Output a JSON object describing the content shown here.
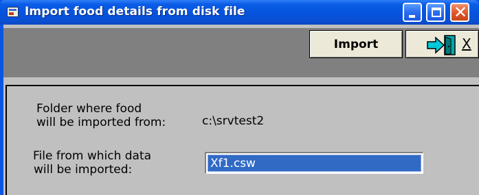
{
  "window": {
    "title": "Import food details from disk file",
    "controls": {
      "minimize": "minimize-icon",
      "maximize": "maximize-icon",
      "close": "close-icon"
    }
  },
  "toolbar": {
    "import_label": "Import",
    "exit_hotkey": "X",
    "exit_icon": "exit-door-icon"
  },
  "form": {
    "folder_label_line1": "Folder where food",
    "folder_label_line2": "will be imported from:",
    "folder_value": "c:\\srvtest2",
    "file_label_line1": "File from which data",
    "file_label_line2": "will be imported:",
    "file_value": "Xf1.csw"
  },
  "colors": {
    "titlebar": "#0653dd",
    "toolbar": "#808080",
    "panel": "#c0c0c0",
    "selection": "#316ac5",
    "close_button": "#e0592f"
  }
}
